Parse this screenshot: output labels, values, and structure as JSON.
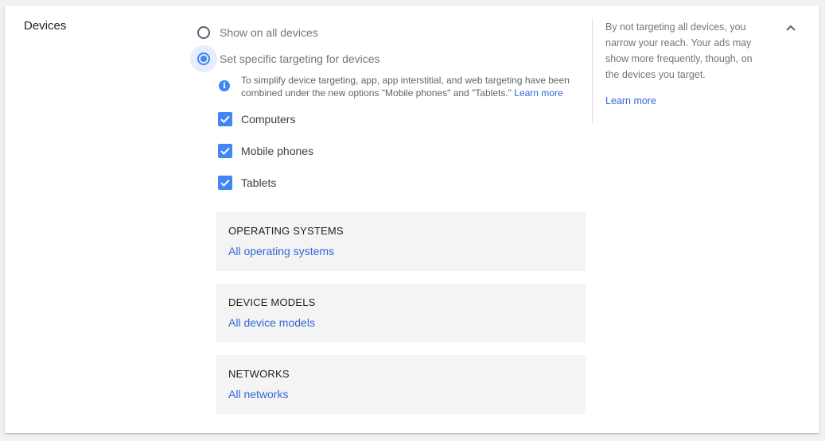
{
  "section": {
    "title": "Devices"
  },
  "targeting": {
    "options": [
      {
        "label": "Show on all devices",
        "selected": false
      },
      {
        "label": "Set specific targeting for devices",
        "selected": true
      }
    ]
  },
  "info": {
    "text": "To simplify device targeting, app, app interstitial, and web targeting have been combined under the new options \"Mobile phones\" and \"Tablets.\"",
    "link": "Learn more"
  },
  "devices": [
    {
      "label": "Computers",
      "checked": true
    },
    {
      "label": "Mobile phones",
      "checked": true
    },
    {
      "label": "Tablets",
      "checked": true
    }
  ],
  "panels": [
    {
      "title": "OPERATING SYSTEMS",
      "value": "All operating systems"
    },
    {
      "title": "DEVICE MODELS",
      "value": "All device models"
    },
    {
      "title": "NETWORKS",
      "value": "All networks"
    }
  ],
  "help": {
    "text": "By not targeting all devices, you narrow your reach. Your ads may show more frequently, though, on the devices you target.",
    "link": "Learn more"
  },
  "icons": {
    "info": "info-icon",
    "checkbox": "check-icon",
    "collapse": "chevron-up-icon"
  },
  "colors": {
    "accent": "#4285f4",
    "link": "#3367d6",
    "panel_bg": "#f4f4f4"
  }
}
